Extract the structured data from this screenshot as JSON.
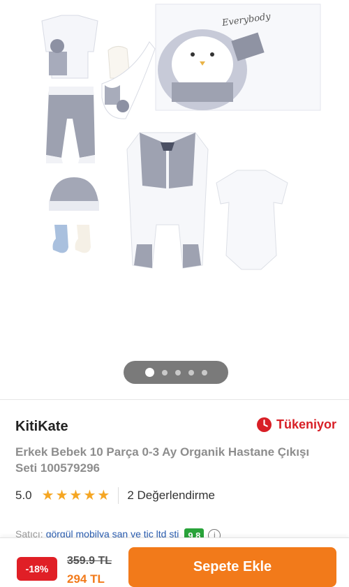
{
  "gallery": {
    "box_print_text": "Everybody",
    "dots_total": 5,
    "active_dot": 1
  },
  "product": {
    "brand": "KitiKate",
    "stock_status": "Tükeniyor",
    "title": "Erkek Bebek 10 Parça 0-3 Ay Organik Hastane Çıkışı Seti 100579296",
    "rating": "5.0",
    "review_count_label": "2 Değerlendirme",
    "stars": 5
  },
  "seller": {
    "label": "Satıcı:",
    "name": "görgül mobilya san ve tic ltd şti",
    "score": "9.8"
  },
  "bottom_bar": {
    "discount": "-18%",
    "old_price": "359.9 TL",
    "new_price": "294 TL",
    "add_to_cart": "Sepete Ekle"
  },
  "colors": {
    "brand_orange": "#f27a1a",
    "discount_red": "#e01f26",
    "stock_red": "#d81f26",
    "star_yellow": "#f5a623",
    "seller_green": "#29a33a"
  }
}
